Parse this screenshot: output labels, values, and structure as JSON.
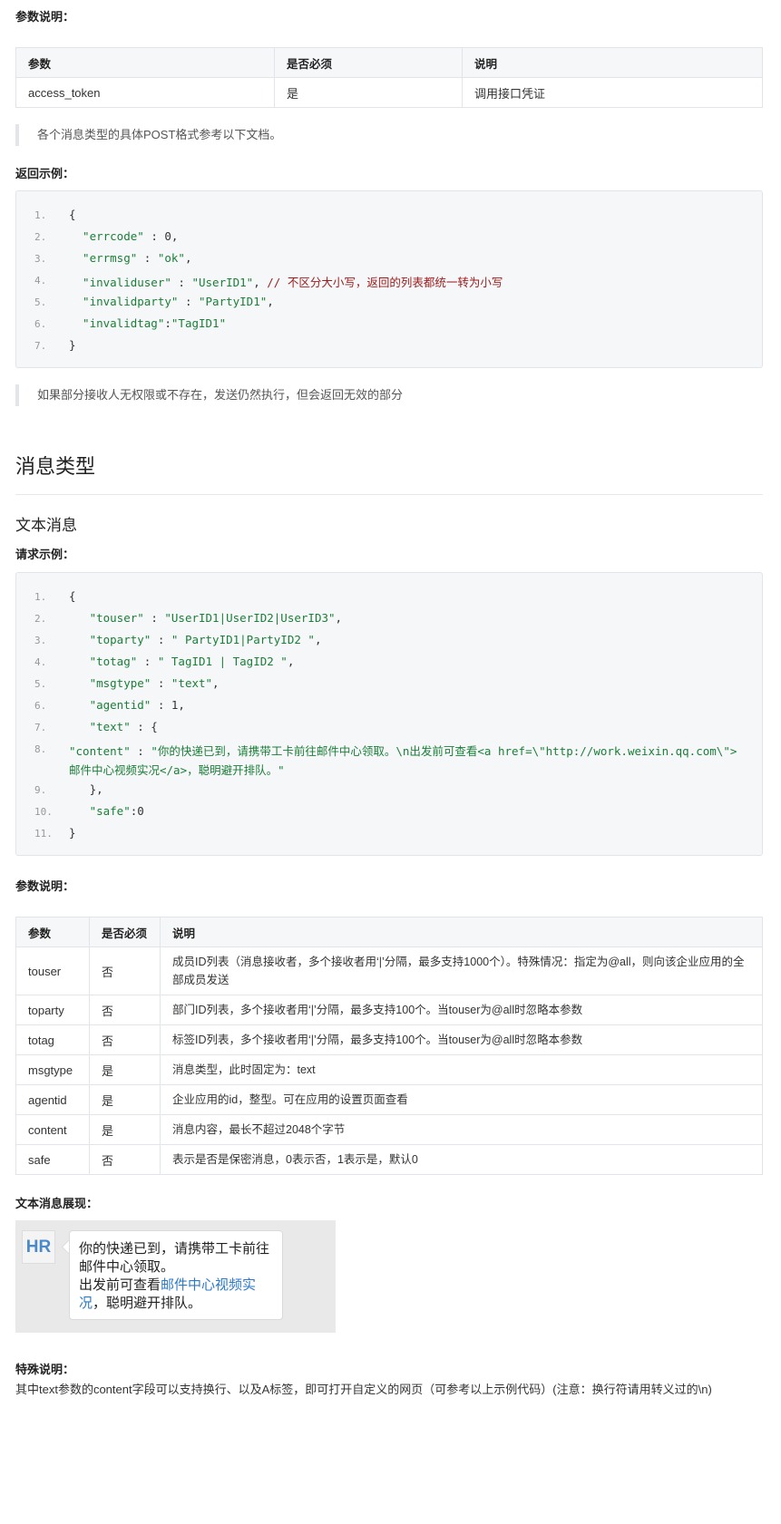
{
  "section1": {
    "params_label": "参数说明：",
    "table": {
      "headers": [
        "参数",
        "是否必须",
        "说明"
      ],
      "rows": [
        [
          "access_token",
          "是",
          "调用接口凭证"
        ]
      ]
    },
    "note": "各个消息类型的具体POST格式参考以下文档。",
    "response_label": "返回示例：",
    "response_code": [
      {
        "n": "1.",
        "parts": [
          {
            "t": "{",
            "c": "plain"
          }
        ]
      },
      {
        "n": "2.",
        "parts": [
          {
            "t": "  \"errcode\"",
            "c": "key"
          },
          {
            "t": " : 0,",
            "c": "plain"
          }
        ]
      },
      {
        "n": "3.",
        "parts": [
          {
            "t": "  \"errmsg\"",
            "c": "key"
          },
          {
            "t": " : ",
            "c": "plain"
          },
          {
            "t": "\"ok\"",
            "c": "str"
          },
          {
            "t": ",",
            "c": "plain"
          }
        ]
      },
      {
        "n": "4.",
        "parts": [
          {
            "t": "  \"invaliduser\"",
            "c": "key"
          },
          {
            "t": " : ",
            "c": "plain"
          },
          {
            "t": "\"UserID1\"",
            "c": "str"
          },
          {
            "t": ", ",
            "c": "plain"
          },
          {
            "t": "// 不区分大小写，返回的列表都统一转为小写",
            "c": "cmt"
          }
        ]
      },
      {
        "n": "5.",
        "parts": [
          {
            "t": "  \"invalidparty\"",
            "c": "key"
          },
          {
            "t": " : ",
            "c": "plain"
          },
          {
            "t": "\"PartyID1\"",
            "c": "str"
          },
          {
            "t": ",",
            "c": "plain"
          }
        ]
      },
      {
        "n": "6.",
        "parts": [
          {
            "t": "  \"invalidtag\"",
            "c": "key"
          },
          {
            "t": ":",
            "c": "plain"
          },
          {
            "t": "\"TagID1\"",
            "c": "str"
          }
        ]
      },
      {
        "n": "7.",
        "parts": [
          {
            "t": "}",
            "c": "plain"
          }
        ]
      }
    ],
    "note2": "如果部分接收人无权限或不存在，发送仍然执行，但会返回无效的部分"
  },
  "section2": {
    "title": "消息类型",
    "subtitle": "文本消息",
    "request_label": "请求示例：",
    "request_code": [
      {
        "n": "1.",
        "parts": [
          {
            "t": "{",
            "c": "plain"
          }
        ]
      },
      {
        "n": "2.",
        "parts": [
          {
            "t": "   \"touser\"",
            "c": "key"
          },
          {
            "t": " : ",
            "c": "plain"
          },
          {
            "t": "\"UserID1|UserID2|UserID3\"",
            "c": "str"
          },
          {
            "t": ",",
            "c": "plain"
          }
        ]
      },
      {
        "n": "3.",
        "parts": [
          {
            "t": "   \"toparty\"",
            "c": "key"
          },
          {
            "t": " : ",
            "c": "plain"
          },
          {
            "t": "\" PartyID1|PartyID2 \"",
            "c": "str"
          },
          {
            "t": ",",
            "c": "plain"
          }
        ]
      },
      {
        "n": "4.",
        "parts": [
          {
            "t": "   \"totag\"",
            "c": "key"
          },
          {
            "t": " : ",
            "c": "plain"
          },
          {
            "t": "\" TagID1 | TagID2 \"",
            "c": "str"
          },
          {
            "t": ",",
            "c": "plain"
          }
        ]
      },
      {
        "n": "5.",
        "parts": [
          {
            "t": "   \"msgtype\"",
            "c": "key"
          },
          {
            "t": " : ",
            "c": "plain"
          },
          {
            "t": "\"text\"",
            "c": "str"
          },
          {
            "t": ",",
            "c": "plain"
          }
        ]
      },
      {
        "n": "6.",
        "parts": [
          {
            "t": "   \"agentid\"",
            "c": "key"
          },
          {
            "t": " : 1,",
            "c": "plain"
          }
        ]
      },
      {
        "n": "7.",
        "parts": [
          {
            "t": "   \"text\"",
            "c": "key"
          },
          {
            "t": " : {",
            "c": "plain"
          }
        ]
      },
      {
        "n": "8.",
        "wrap": true,
        "parts": [
          {
            "t": "       \"content\"",
            "c": "key"
          },
          {
            "t": " : ",
            "c": "plain"
          },
          {
            "t": "\"你的快递已到，请携带工卡前往邮件中心领取。\\n出发前可查看<a href=\\\"http://work.weixin.qq.com\\\">邮件中心视频实况</a>，聪明避开排队。\"",
            "c": "str"
          }
        ]
      },
      {
        "n": "9.",
        "parts": [
          {
            "t": "   },",
            "c": "plain"
          }
        ]
      },
      {
        "n": "10.",
        "parts": [
          {
            "t": "   \"safe\"",
            "c": "key"
          },
          {
            "t": ":0",
            "c": "plain"
          }
        ]
      },
      {
        "n": "11.",
        "parts": [
          {
            "t": "}",
            "c": "plain"
          }
        ]
      }
    ],
    "params_label": "参数说明：",
    "table": {
      "headers": [
        "参数",
        "是否必须",
        "说明"
      ],
      "rows": [
        [
          "touser",
          "否",
          "成员ID列表（消息接收者，多个接收者用‘|’分隔，最多支持1000个）。特殊情况：指定为@all，则向该企业应用的全部成员发送"
        ],
        [
          "toparty",
          "否",
          "部门ID列表，多个接收者用‘|’分隔，最多支持100个。当touser为@all时忽略本参数"
        ],
        [
          "totag",
          "否",
          "标签ID列表，多个接收者用‘|’分隔，最多支持100个。当touser为@all时忽略本参数"
        ],
        [
          "msgtype",
          "是",
          "消息类型，此时固定为：text"
        ],
        [
          "agentid",
          "是",
          "企业应用的id，整型。可在应用的设置页面查看"
        ],
        [
          "content",
          "是",
          "消息内容，最长不超过2048个字节"
        ],
        [
          "safe",
          "否",
          "表示是否是保密消息，0表示否，1表示是，默认0"
        ]
      ]
    },
    "display_label": "文本消息展现：",
    "preview": {
      "avatar_text": "HR",
      "line1": "你的快递已到，请携带工卡前往邮件中心领取。",
      "line2_prefix": "出发前可查看",
      "link_text": "邮件中心视频实况",
      "line2_suffix": "，聪明避开排队。",
      "link_color": "#2d79c7"
    },
    "special_label": "特殊说明：",
    "special_text": "其中text参数的content字段可以支持换行、以及A标签，即可打开自定义的网页（可参考以上示例代码）(注意：换行符请用转义过的\\n)"
  }
}
